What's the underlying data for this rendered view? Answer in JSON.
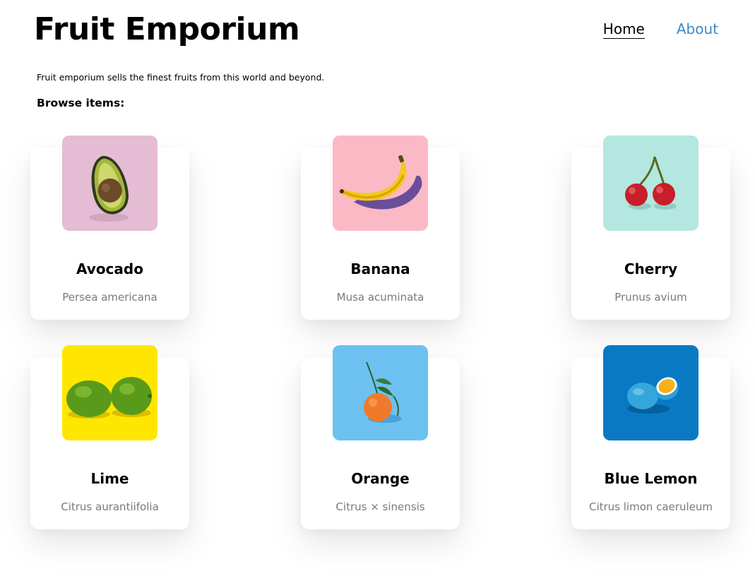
{
  "header": {
    "title": "Fruit Emporium",
    "nav": [
      {
        "label": "Home",
        "active": true
      },
      {
        "label": "About",
        "active": false
      }
    ]
  },
  "intro": "Fruit emporium sells the finest fruits from this world and beyond.",
  "browse_heading": "Browse items:",
  "items": [
    {
      "name": "Avocado",
      "scientific": "Persea americana",
      "image": "avocado-image",
      "bg": "#e4bcd3"
    },
    {
      "name": "Banana",
      "scientific": "Musa acuminata",
      "image": "banana-image",
      "bg": "#fbb9c5"
    },
    {
      "name": "Cherry",
      "scientific": "Prunus avium",
      "image": "cherry-image",
      "bg": "#b4e7df"
    },
    {
      "name": "Lime",
      "scientific": "Citrus aurantiifolia",
      "image": "lime-image",
      "bg": "#ffe600"
    },
    {
      "name": "Orange",
      "scientific": "Citrus × sinensis",
      "image": "orange-image",
      "bg": "#6dc1f0"
    },
    {
      "name": "Blue Lemon",
      "scientific": "Citrus limon caeruleum",
      "image": "blue-lemon-image",
      "bg": "#0a79c3"
    }
  ],
  "colors": {
    "nav_link": "#3f88c5",
    "scientific_text": "#7a7a7a"
  }
}
